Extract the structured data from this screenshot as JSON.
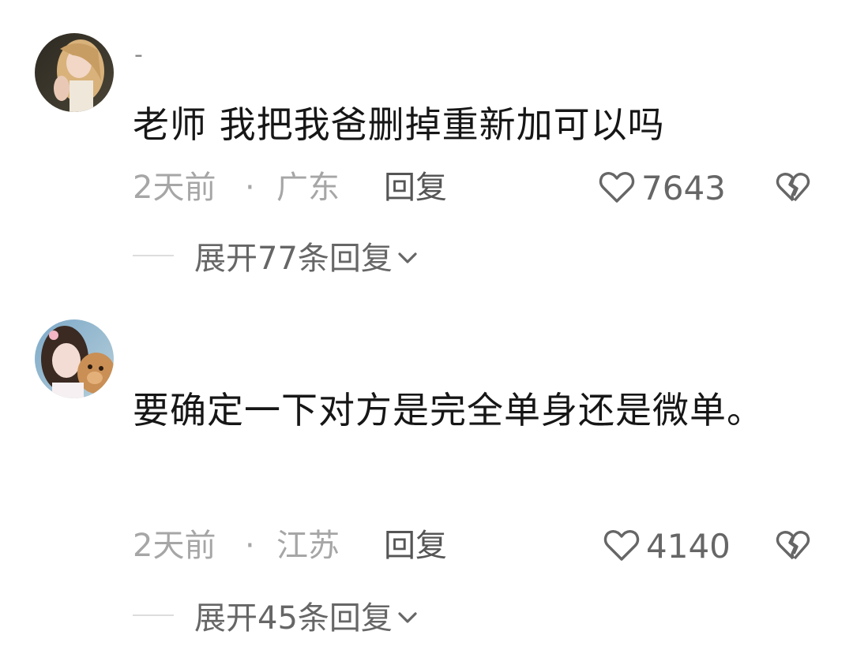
{
  "comments": [
    {
      "username": "-",
      "text": "老师 我把我爸删掉重新加可以吗",
      "time": "2天前",
      "separator": "·",
      "location": "广东",
      "reply_label": "回复",
      "likes": "7643",
      "expand_label": "展开77条回复"
    },
    {
      "username": "",
      "text": "要确定一下对方是完全单身还是微单。",
      "time": "2天前",
      "separator": "·",
      "location": "江苏",
      "reply_label": "回复",
      "likes": "4140",
      "expand_label": "展开45条回复"
    }
  ],
  "icons": {
    "like": "heart-outline-icon",
    "dislike": "broken-heart-icon",
    "expand": "chevron-down-icon"
  },
  "colors": {
    "text": "#161616",
    "meta": "#a6a6a6",
    "reply": "#555555"
  }
}
